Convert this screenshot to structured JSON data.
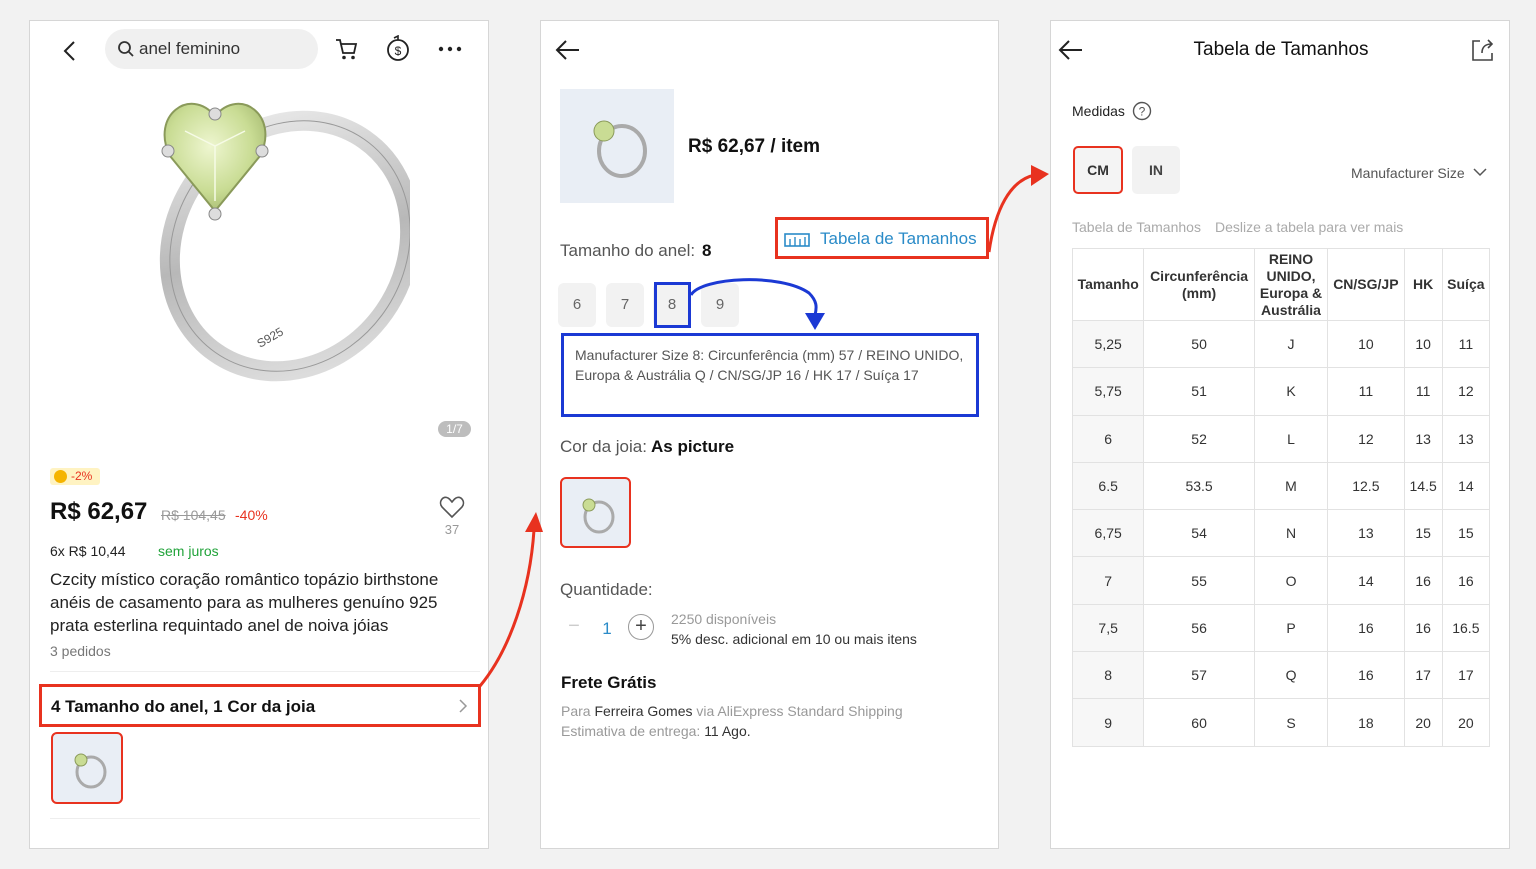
{
  "search": {
    "query": "anel feminino"
  },
  "product": {
    "image_counter": "1/7",
    "coin_badge": "-2%",
    "price": "R$ 62,67",
    "old_price": "R$ 104,45",
    "discount": "-40%",
    "wishlist_count": "37",
    "installments": "6x R$ 10,44",
    "installments_note": "sem juros",
    "title": "Czcity místico coração romântico topázio birthstone anéis de casamento para as mulheres genuíno 925 prata esterlina requintado anel de noiva jóias",
    "orders": "3 pedidos",
    "variants_summary": "4 Tamanho do anel, 1 Cor da joia",
    "ring_engraving": "S925"
  },
  "sku": {
    "price_per_item": "R$ 62,67 / item",
    "size_label": "Tamanho do anel:",
    "size_selected": "8",
    "size_chart_link": "Tabela de Tamanhos",
    "sizes": [
      "6",
      "7",
      "8",
      "9"
    ],
    "size_description": "Manufacturer Size 8: Circunferência (mm) 57 / REINO UNIDO, Europa & Austrália Q / CN/SG/JP 16 / HK 17 / Suíça 17",
    "color_label": "Cor da joia:",
    "color_selected": "As picture",
    "quantity_label": "Quantidade:",
    "quantity_minus": "−",
    "quantity_value": "1",
    "quantity_plus": "+",
    "available": "2250 disponíveis",
    "bulk_discount": "5% desc. adicional em 10 ou mais itens",
    "shipping_title": "Frete Grátis",
    "shipping_to_prefix": "Para",
    "shipping_to_name": "Ferreira Gomes",
    "shipping_via": "via AliExpress Standard Shipping",
    "delivery_prefix": "Estimativa de entrega:",
    "delivery_date": "11 Ago."
  },
  "size_chart": {
    "title": "Tabela de Tamanhos",
    "measures_label": "Medidas",
    "unit_cm": "CM",
    "unit_in": "IN",
    "size_system": "Manufacturer Size",
    "table_caption": "Tabela de Tamanhos",
    "table_hint": "Deslize a tabela para ver mais",
    "headers": [
      "Tamanho",
      "Circunferência (mm)",
      "REINO UNIDO, Europa & Austrália",
      "CN/SG/JP",
      "HK",
      "Suíça"
    ],
    "rows": [
      [
        "5,25",
        "50",
        "J",
        "10",
        "10",
        "11"
      ],
      [
        "5,75",
        "51",
        "K",
        "11",
        "11",
        "12"
      ],
      [
        "6",
        "52",
        "L",
        "12",
        "13",
        "13"
      ],
      [
        "6.5",
        "53.5",
        "M",
        "12.5",
        "14.5",
        "14"
      ],
      [
        "6,75",
        "54",
        "N",
        "13",
        "15",
        "15"
      ],
      [
        "7",
        "55",
        "O",
        "14",
        "16",
        "16"
      ],
      [
        "7,5",
        "56",
        "P",
        "16",
        "16",
        "16.5"
      ],
      [
        "8",
        "57",
        "Q",
        "16",
        "17",
        "17"
      ],
      [
        "9",
        "60",
        "S",
        "18",
        "20",
        "20"
      ]
    ]
  },
  "colors": {
    "highlight_red": "#e8321f",
    "highlight_blue": "#1b39d4",
    "link_blue": "#2a8bc8",
    "price_red": "#e8321f",
    "green": "#21a33a"
  }
}
